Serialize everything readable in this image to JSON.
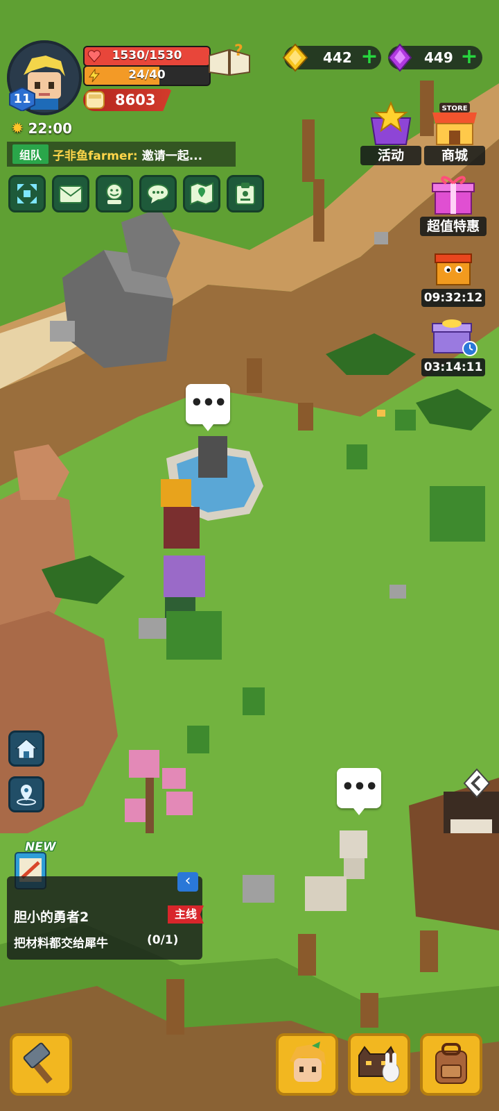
{
  "player": {
    "level": "11",
    "time": "22:00",
    "hp_text": "1530/1530",
    "hp_fraction": 1.0,
    "energy_text": "24/40",
    "energy_fraction": 0.6,
    "power": "8603"
  },
  "currency": {
    "gold": "442",
    "gems": "449",
    "add_symbol": "+"
  },
  "chat": {
    "tag": "组队",
    "sender": "子非鱼farmer:",
    "message": "邀请一起..."
  },
  "menu_icons": [
    "expand-icon",
    "mail-icon",
    "friends-icon",
    "chat-icon",
    "map-icon",
    "clipboard-icon"
  ],
  "side_buttons": {
    "events_label": "活动",
    "store_sign": "STORE",
    "store_label": "商城",
    "deal_label": "超值特惠",
    "timer1": "09:32:12",
    "timer2": "03:14:11"
  },
  "speech_bubble": "•••",
  "quest": {
    "new_badge": "NEW",
    "collapse_icon": "‹",
    "title": "胆小的勇者2",
    "tag": "主线",
    "desc": "把材料都交给犀牛",
    "progress": "(0/1)"
  },
  "colors": {
    "grass": "#6fae3c",
    "hp": "#e8463a",
    "energy": "#f39a26",
    "gold_button": "#f2b720",
    "menu_green": "#1e5a3a"
  }
}
